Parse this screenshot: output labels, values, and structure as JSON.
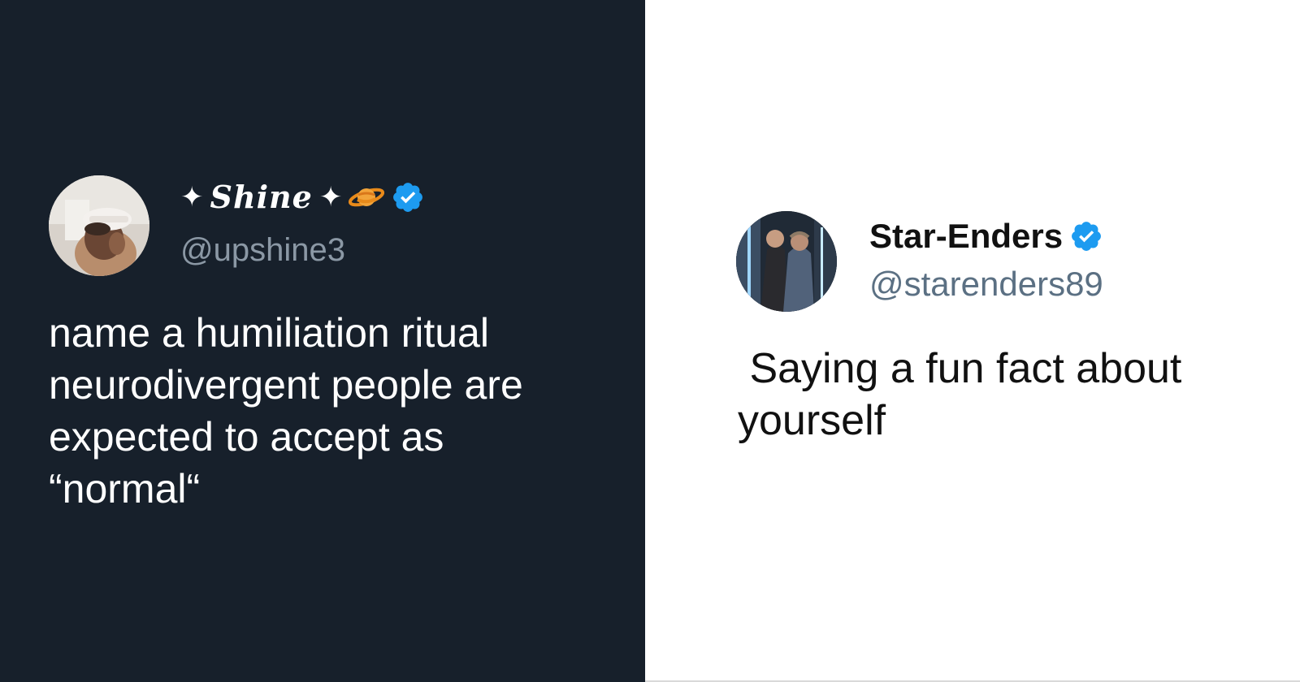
{
  "tweet_left": {
    "display_name": "Shine",
    "name_decoration": "✦",
    "emoji": "planet-emoji",
    "handle": "@upshine3",
    "verified": true,
    "text_lines": [
      "name a humiliation ritual",
      "neurodivergent people are",
      "expected to accept as",
      "“normal“"
    ],
    "background_color": "#17202b"
  },
  "tweet_right": {
    "display_name": "Star-Enders",
    "handle": "@starenders89",
    "verified": true,
    "text_lines": [
      " Saying a fun fact about",
      "yourself"
    ],
    "background_color": "#ffffff"
  },
  "colors": {
    "verified_blue": "#1d9bf0",
    "handle_gray_dark": "#8b98a5",
    "handle_gray_light": "#5b7083"
  }
}
